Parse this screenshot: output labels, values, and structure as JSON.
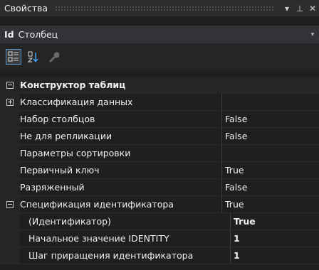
{
  "window": {
    "title": "Свойства",
    "dropdown_glyph": "▾",
    "pin_glyph": "⊥",
    "close_glyph": "✕"
  },
  "object": {
    "kind": "Id",
    "name": "Столбец",
    "dropdown_glyph": "▾"
  },
  "toolbar": {
    "categorized_icon": "categorized-icon",
    "alphabetical_icon": "sort-alpha-icon",
    "property_pages_icon": "wrench-icon"
  },
  "rows": [
    {
      "name": "Конструктор таблиц",
      "value": "",
      "type": "category",
      "expander": "collapse"
    },
    {
      "name": "Классификация данных",
      "value": "",
      "type": "expandable",
      "expander": "expand"
    },
    {
      "name": "Набор столбцов",
      "value": "False"
    },
    {
      "name": "Не для репликации",
      "value": "False"
    },
    {
      "name": "Параметры сортировки",
      "value": ""
    },
    {
      "name": "Первичный ключ",
      "value": "True"
    },
    {
      "name": "Разряженный",
      "value": "False"
    },
    {
      "name": "Спецификация идентификатора",
      "value": "True",
      "type": "expandable",
      "expander": "collapse"
    },
    {
      "name": "(Идентификатор)",
      "value": "True",
      "child": true,
      "bold": true
    },
    {
      "name": "Начальное значение IDENTITY",
      "value": "1",
      "child": true,
      "bold": true
    },
    {
      "name": "Шаг приращения идентификатора",
      "value": "1",
      "child": true,
      "bold": true
    }
  ],
  "colors": {
    "background": "#1f1f1f",
    "accent": "#5b8fc7",
    "text": "#f1f1f1"
  }
}
